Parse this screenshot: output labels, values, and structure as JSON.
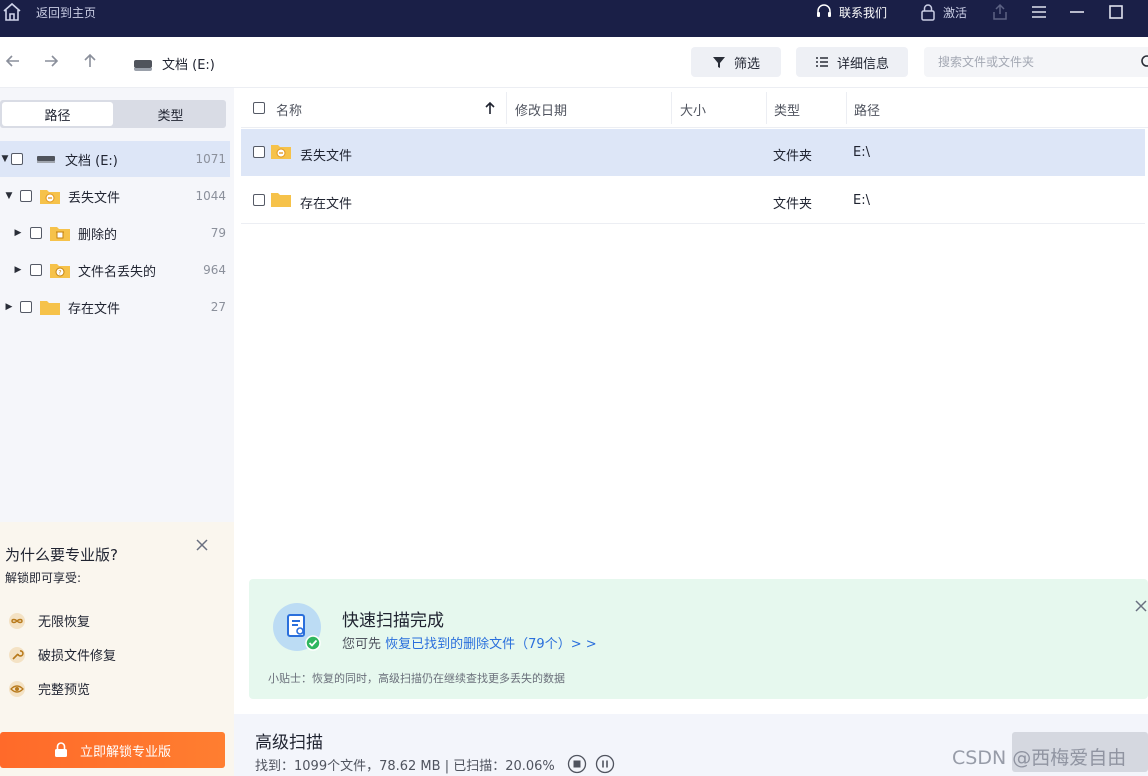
{
  "titlebar": {
    "home_label": "返回到主页",
    "contact_label": "联系我们",
    "activate_label": "激活"
  },
  "toolbar": {
    "drive_label": "文档 (E:)",
    "filter_label": "筛选",
    "details_label": "详细信息",
    "search_placeholder": "搜索文件或文件夹"
  },
  "sidebar": {
    "tabs": [
      {
        "label": "路径",
        "active": true
      },
      {
        "label": "类型",
        "active": false
      }
    ],
    "tree": [
      {
        "label": "文档 (E:)",
        "count": "1071",
        "icon": "drive-icon",
        "expanded": true
      },
      {
        "label": "丢失文件",
        "count": "1044",
        "icon": "lost-folder-icon",
        "expanded": true
      },
      {
        "label": "删除的",
        "count": "79",
        "icon": "deleted-folder-icon",
        "expanded": false
      },
      {
        "label": "文件名丢失的",
        "count": "964",
        "icon": "unknown-folder-icon",
        "expanded": false
      },
      {
        "label": "存在文件",
        "count": "27",
        "icon": "folder-icon",
        "expanded": false
      }
    ]
  },
  "promo": {
    "title": "为什么要专业版?",
    "subtitle": "解锁即可享受:",
    "features": [
      {
        "label": "无限恢复",
        "icon": "infinity-icon"
      },
      {
        "label": "破损文件修复",
        "icon": "wrench-icon"
      },
      {
        "label": "完整预览",
        "icon": "eye-icon"
      }
    ],
    "unlock_label": "立即解锁专业版"
  },
  "list": {
    "columns": [
      "名称",
      "修改日期",
      "大小",
      "类型",
      "路径"
    ],
    "rows": [
      {
        "name": "丢失文件",
        "date": "",
        "size": "",
        "type": "文件夹",
        "path": "E:\\",
        "icon": "lost-folder-icon"
      },
      {
        "name": "存在文件",
        "date": "",
        "size": "",
        "type": "文件夹",
        "path": "E:\\",
        "icon": "folder-icon"
      }
    ]
  },
  "banner": {
    "title": "快速扫描完成",
    "prefix": "您可先",
    "link": "恢复已找到的删除文件（79个）> >",
    "tip": "小贴士：恢复的同时，高级扫描仍在继续查找更多丢失的数据"
  },
  "status": {
    "title": "高级扫描",
    "info": "找到：1099个文件，78.62 MB | 已扫描：20.06%"
  },
  "watermark": "CSDN @西梅爱自由",
  "colors": {
    "titlebar": "#1a1f47",
    "selection": "#dde6f7",
    "accent_orange": "#ff6a2a",
    "link_blue": "#2a6fdc",
    "banner_green": "#e6f8ee",
    "folder_yellow": "#f6c24a"
  }
}
